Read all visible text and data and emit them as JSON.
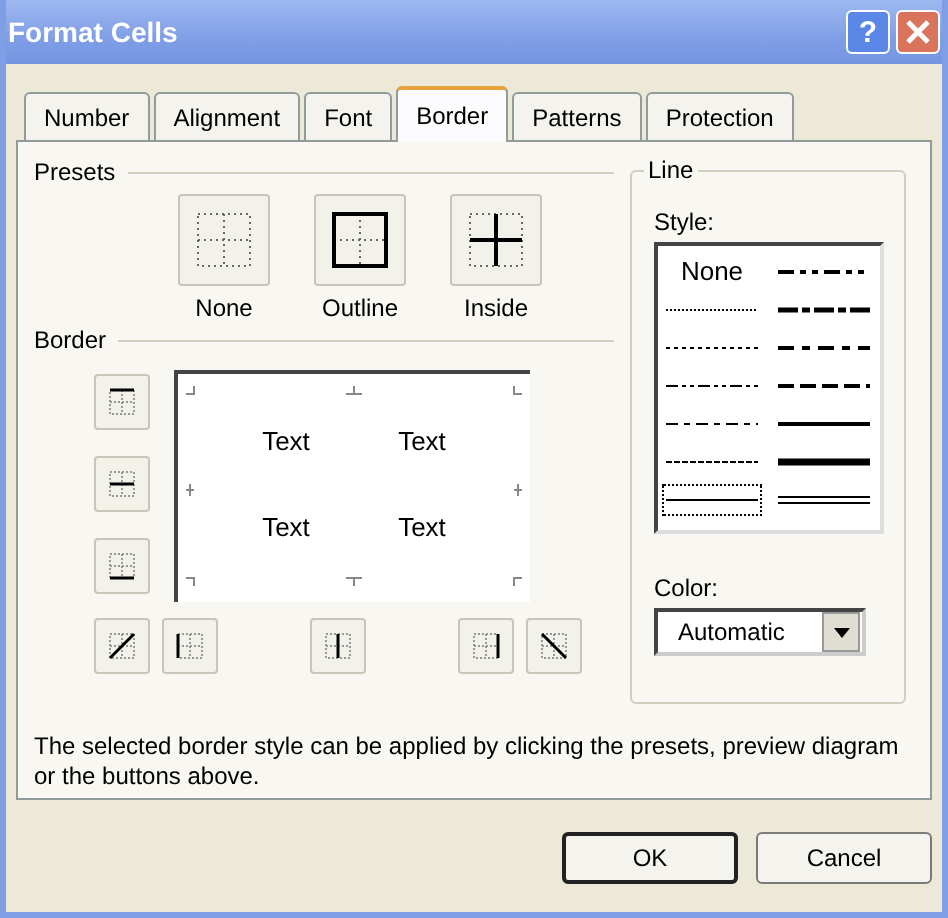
{
  "window": {
    "title": "Format Cells",
    "help_label": "?"
  },
  "tabs": [
    {
      "label": "Number",
      "selected": false
    },
    {
      "label": "Alignment",
      "selected": false
    },
    {
      "label": "Font",
      "selected": false
    },
    {
      "label": "Border",
      "selected": true
    },
    {
      "label": "Patterns",
      "selected": false
    },
    {
      "label": "Protection",
      "selected": false
    }
  ],
  "presets": {
    "label": "Presets",
    "buttons": [
      {
        "kind": "none",
        "label": "None"
      },
      {
        "kind": "outline",
        "label": "Outline"
      },
      {
        "kind": "inside",
        "label": "Inside"
      }
    ]
  },
  "border": {
    "label": "Border",
    "preview_texts": [
      "Text",
      "Text",
      "Text",
      "Text"
    ],
    "side_buttons": [
      {
        "kind": "top"
      },
      {
        "kind": "middle"
      },
      {
        "kind": "bottom"
      }
    ],
    "bottom_buttons": [
      {
        "kind": "diag-up"
      },
      {
        "kind": "left"
      },
      {
        "kind": "center"
      },
      {
        "kind": "right"
      },
      {
        "kind": "diag-down"
      }
    ]
  },
  "line": {
    "label": "Line",
    "style_label": "Style:",
    "color_label": "Color:",
    "color_value": "Automatic",
    "styles": [
      {
        "kind": "none",
        "label": "None",
        "selected": false
      },
      {
        "kind": "hair",
        "selected": false
      },
      {
        "kind": "dotted",
        "selected": false
      },
      {
        "kind": "dash-dot-dot",
        "selected": false
      },
      {
        "kind": "dash-dot",
        "selected": false
      },
      {
        "kind": "dashed",
        "selected": false
      },
      {
        "kind": "thin",
        "selected": true
      },
      {
        "kind": "medium-dash-dot-dot",
        "selected": false
      },
      {
        "kind": "slant-dash-dot",
        "selected": false
      },
      {
        "kind": "medium-dash-dot",
        "selected": false
      },
      {
        "kind": "medium-dashed",
        "selected": false
      },
      {
        "kind": "medium",
        "selected": false
      },
      {
        "kind": "thick",
        "selected": false
      },
      {
        "kind": "double",
        "selected": false
      }
    ]
  },
  "description": "The selected border style can be applied by clicking the presets, preview diagram or the buttons above.",
  "buttons": [
    {
      "label": "OK",
      "default": true
    },
    {
      "label": "Cancel",
      "default": false
    }
  ]
}
